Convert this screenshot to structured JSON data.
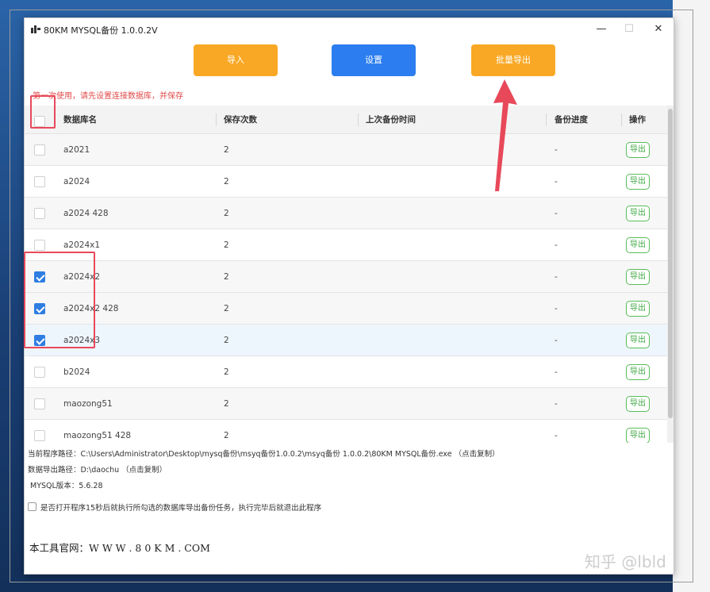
{
  "window": {
    "title": "80KM MYSQL备份 1.0.0.2V",
    "minimize_glyph": "—",
    "maximize_glyph": "☐",
    "close_glyph": "✕"
  },
  "toolbar": {
    "import_label": "导入",
    "settings_label": "设置",
    "batch_export_label": "批量导出",
    "import_color": "#f9a825",
    "settings_color": "#2c7ef0",
    "batch_export_color": "#f9a825"
  },
  "notice": "第一次使用，请先设置连接数据库，并保存",
  "table": {
    "headers": {
      "name": "数据库名",
      "count": "保存次数",
      "last_time": "上次备份时间",
      "progress": "备份进度",
      "action": "操作"
    },
    "rows": [
      {
        "name": "a2021",
        "count": "2",
        "last_time": "",
        "progress": "-",
        "action": "导出",
        "checked": false
      },
      {
        "name": "a2024",
        "count": "2",
        "last_time": "",
        "progress": "-",
        "action": "导出",
        "checked": false
      },
      {
        "name": "a2024 428",
        "count": "2",
        "last_time": "",
        "progress": "-",
        "action": "导出",
        "checked": false
      },
      {
        "name": "a2024x1",
        "count": "2",
        "last_time": "",
        "progress": "-",
        "action": "导出",
        "checked": false
      },
      {
        "name": "a2024x2",
        "count": "2",
        "last_time": "",
        "progress": "-",
        "action": "导出",
        "checked": true
      },
      {
        "name": "a2024x2 428",
        "count": "2",
        "last_time": "",
        "progress": "-",
        "action": "导出",
        "checked": true
      },
      {
        "name": "a2024x3",
        "count": "2",
        "last_time": "",
        "progress": "-",
        "action": "导出",
        "checked": true
      },
      {
        "name": "b2024",
        "count": "2",
        "last_time": "",
        "progress": "-",
        "action": "导出",
        "checked": false
      },
      {
        "name": "maozong51",
        "count": "2",
        "last_time": "",
        "progress": "-",
        "action": "导出",
        "checked": false
      },
      {
        "name": "maozong51 428",
        "count": "2",
        "last_time": "",
        "progress": "-",
        "action": "导出",
        "checked": false
      }
    ]
  },
  "info": {
    "program_path": "当前程序路径：C:\\Users\\Administrator\\Desktop\\mysq备份\\msyq备份1.0.0.2\\msyq备份 1.0.0.2\\80KM MYSQL备份.exe （点击复制）",
    "export_path": "数据导出路径：D:\\daochu （点击复制）",
    "mysql_version": "MYSQL版本：5.6.28",
    "auto_export_label": "是否打开程序15秒后就执行所勾选的数据库导出备份任务，执行完毕后就退出此程序",
    "site": "本工具官网：W W W . 8 0 K M . COM"
  },
  "watermark": "知乎 @lbld",
  "annotation_color": "#e8495a"
}
